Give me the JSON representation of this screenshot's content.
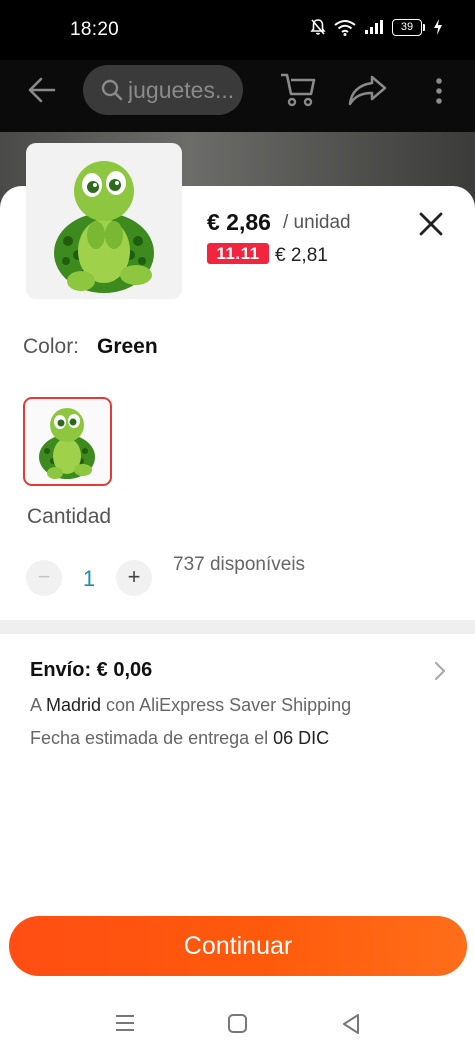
{
  "status_bar": {
    "time": "18:20",
    "battery": "39",
    "icons": [
      "mute-icon",
      "wifi-icon",
      "signal-icon",
      "battery-icon",
      "charging-icon"
    ]
  },
  "header": {
    "search_text": "juguetes...",
    "icons": [
      "back-arrow-icon",
      "search-icon",
      "cart-icon",
      "share-icon",
      "more-icon"
    ]
  },
  "sheet": {
    "price": "€ 2,86",
    "price_unit": "/ unidad",
    "promo_badge": "11.11",
    "promo_price": "€ 2,81",
    "color_label": "Color:",
    "color_value": "Green",
    "quantity_label": "Cantidad",
    "quantity_minus": "−",
    "quantity_value": "1",
    "quantity_plus": "+",
    "available": "737 disponíveis"
  },
  "shipping": {
    "title": "Envío: € 0,06",
    "line1_prefix": "A ",
    "line1_city": "Madrid",
    "line1_suffix": " con AliExpress Saver Shipping",
    "line2_prefix": "Fecha estimada de entrega el ",
    "line2_date": "06 DIC"
  },
  "continue_label": "Continuar",
  "colors": {
    "accent_orange": "#ff5a0c",
    "promo_red": "#f2253f",
    "qty_blue": "#1a8fb4",
    "swatch_border": "#e63a3a"
  }
}
